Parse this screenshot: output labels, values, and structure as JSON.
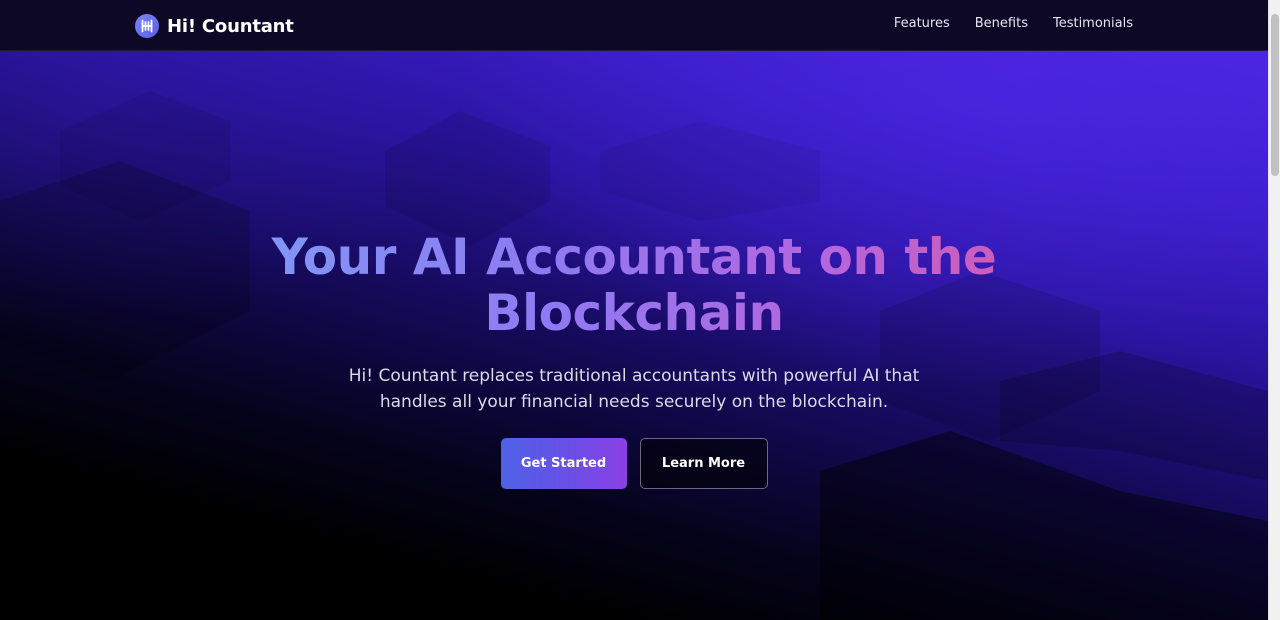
{
  "header": {
    "brand_name": "Hi! Countant",
    "brand_logo_icon": "hicountant-logo-icon",
    "nav_links": [
      {
        "label": "Features"
      },
      {
        "label": "Benefits"
      },
      {
        "label": "Testimonials"
      }
    ]
  },
  "hero": {
    "title_line1": "Your AI Accountant on the",
    "title_line2": "Blockchain",
    "subtitle": "Hi! Countant replaces traditional accountants with powerful AI that handles all your financial needs securely on the blockchain.",
    "primary_button": "Get Started",
    "secondary_button": "Learn More"
  },
  "colors": {
    "header_bg": "#0c0826",
    "hero_purple": "#4a26e0",
    "title_gradient_start": "#7f9cf6",
    "title_gradient_end": "#d65aac",
    "primary_button_start": "#4f62e6",
    "primary_button_end": "#8b3fe3"
  }
}
